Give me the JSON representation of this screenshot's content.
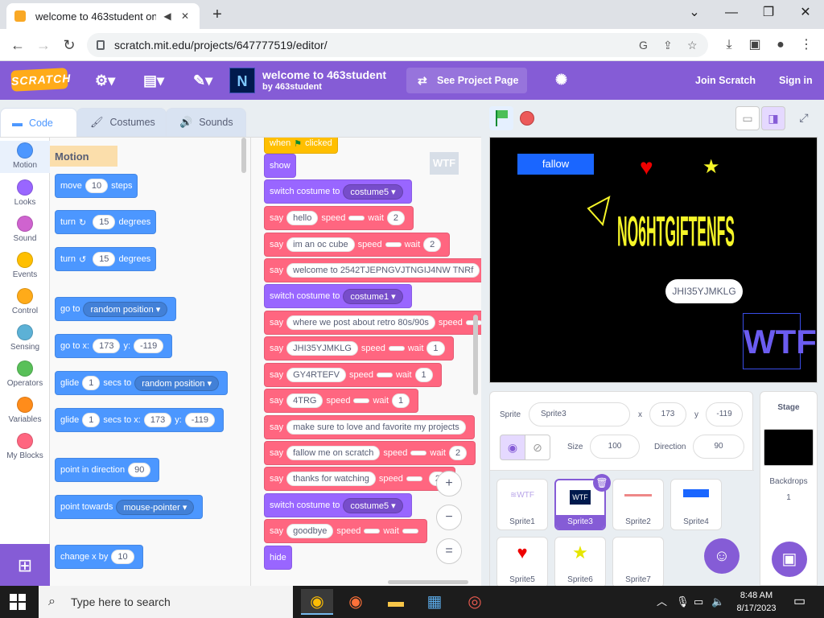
{
  "browser": {
    "tab_title": "welcome to 463student on S",
    "url": "scratch.mit.edu/projects/647777519/editor/",
    "min": "⌄",
    "close": "✕"
  },
  "menubar": {
    "logo": "SCRATCH",
    "project_title": "welcome to 463student",
    "project_author": "by 463student",
    "see_project": "See Project Page",
    "join": "Join Scratch",
    "signin": "Sign in",
    "accent": "#855cd6"
  },
  "editor_tabs": {
    "code": "Code",
    "costumes": "Costumes",
    "sounds": "Sounds"
  },
  "categories": [
    {
      "label": "Motion",
      "color": "#4c97ff"
    },
    {
      "label": "Looks",
      "color": "#9966ff"
    },
    {
      "label": "Sound",
      "color": "#cf63cf"
    },
    {
      "label": "Events",
      "color": "#ffbf00"
    },
    {
      "label": "Control",
      "color": "#ffab19"
    },
    {
      "label": "Sensing",
      "color": "#5cb1d6"
    },
    {
      "label": "Operators",
      "color": "#59c059"
    },
    {
      "label": "Variables",
      "color": "#ff8c1a"
    },
    {
      "label": "My Blocks",
      "color": "#ff6680"
    }
  ],
  "palette": {
    "title": "Motion",
    "move": {
      "a": "move",
      "v": "10",
      "b": "steps"
    },
    "turn_right": {
      "a": "turn",
      "v": "15",
      "b": "degrees"
    },
    "turn_left": {
      "a": "turn",
      "v": "15",
      "b": "degrees"
    },
    "goto": {
      "a": "go to",
      "dd": "random position"
    },
    "gotoxy": {
      "a": "go to x:",
      "x": "173",
      "b": "y:",
      "y": "-119"
    },
    "glide1": {
      "a": "glide",
      "v": "1",
      "b": "secs to",
      "dd": "random position"
    },
    "glide2": {
      "a": "glide",
      "v": "1",
      "b": "secs to x:",
      "x": "173",
      "c": "y:",
      "y": "-119"
    },
    "point_dir": {
      "a": "point in direction",
      "v": "90"
    },
    "point_towards": {
      "a": "point towards",
      "dd": "mouse-pointer"
    },
    "change_x": {
      "a": "change x by",
      "v": "10"
    }
  },
  "script": {
    "when": "when",
    "clicked": "clicked",
    "show": "show",
    "switch_label": "switch costume to",
    "costume5": "costume5",
    "costume1": "costume1",
    "say": "say",
    "speed": "speed",
    "wait": "wait",
    "hide": "hide",
    "lines": [
      {
        "text": "hello",
        "wait": "2"
      },
      {
        "text": "im an oc cube",
        "wait": "2"
      },
      {
        "text": "welcome to 2542TJEPNGVJTNGIJ4NW TNRf",
        "wait": ""
      },
      {
        "text": "where we post about retro 80s/90s",
        "wait": ""
      },
      {
        "text": "JHI35YJMKLG",
        "wait": "1"
      },
      {
        "text": "GY4RTEFV",
        "wait": "1"
      },
      {
        "text": "4TRG",
        "wait": "1"
      },
      {
        "text": "make sure to love and favorite my projects",
        "wait": ""
      },
      {
        "text": "fallow me on scratch",
        "wait": "2"
      },
      {
        "text": "thanks for watching",
        "wait": "2"
      },
      {
        "text": "goodbye",
        "wait": ""
      }
    ],
    "zoom_in": "+",
    "zoom_out": "−",
    "zoom_reset": "="
  },
  "stage": {
    "fallow_button": "fallow",
    "big_text": "NO6HTGIFTENFS",
    "bubble": "JHI35YJMKLG",
    "wtf": "WTF"
  },
  "sprite_info": {
    "sprite_label": "Sprite",
    "sprite_name": "Sprite3",
    "x_label": "x",
    "x": "173",
    "y_label": "y",
    "y": "-119",
    "show_label": "Show",
    "size_label": "Size",
    "size": "100",
    "direction_label": "Direction",
    "direction": "90"
  },
  "sprites": [
    {
      "name": "Sprite1"
    },
    {
      "name": "Sprite3"
    },
    {
      "name": "Sprite2"
    },
    {
      "name": "Sprite4"
    },
    {
      "name": "Sprite5"
    },
    {
      "name": "Sprite6"
    },
    {
      "name": "Sprite7"
    }
  ],
  "stage_pane": {
    "title": "Stage",
    "backdrops_label": "Backdrops",
    "backdrops_count": "1"
  },
  "taskbar": {
    "search_placeholder": "Type here to search",
    "time": "8:48 AM",
    "date": "8/17/2023"
  }
}
